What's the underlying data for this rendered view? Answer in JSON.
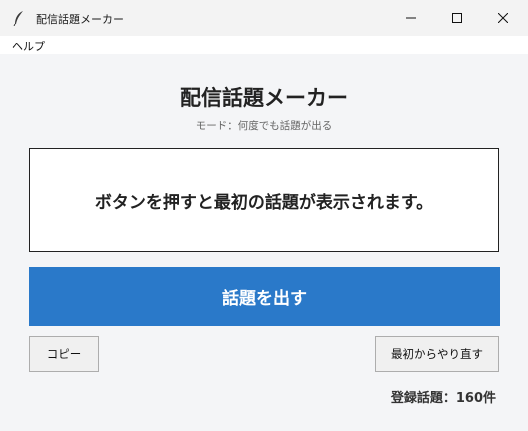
{
  "window": {
    "title": "配信話題メーカー",
    "icon": "feather-icon"
  },
  "menu": {
    "items": [
      {
        "label": "ヘルプ"
      }
    ]
  },
  "main": {
    "heading": "配信話題メーカー",
    "mode": "モード：何度でも話題が出る",
    "topic": "ボタンを押すと最初の話題が表示されます。",
    "primary_button": "話題を出す",
    "copy_button": "コピー",
    "reset_button": "最初からやり直す",
    "count": "登録話題：160件"
  },
  "colors": {
    "primary": "#2a79c9",
    "background": "#f4f5f7",
    "box_background": "#ffffff"
  }
}
